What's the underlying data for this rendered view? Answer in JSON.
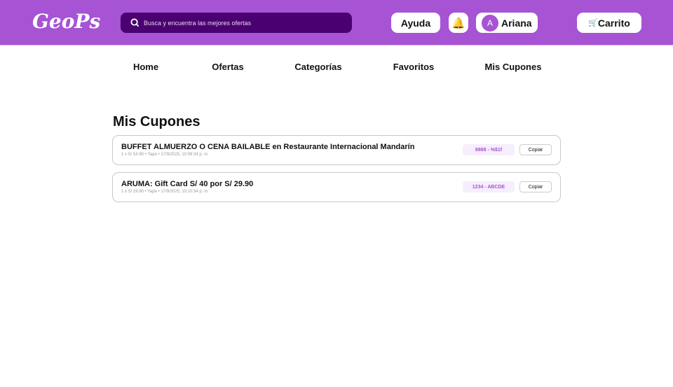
{
  "header": {
    "logo": "GeoPs",
    "search_placeholder": "Busca y encuentra las mejores ofertas",
    "help": "Ayuda",
    "bell": "🔔",
    "avatar_initial": "A",
    "user": "Ariana",
    "cart_icon": "🛒",
    "cart": "Carrito"
  },
  "nav": [
    "Home",
    "Ofertas",
    "Categorías",
    "Favoritos",
    "Mis Cupones"
  ],
  "page_title": "Mis Cupones",
  "coupons": [
    {
      "title": "BUFFET ALMUERZO O CENA BAILABLE en Restaurante Internacional Mandarín",
      "meta": "1 x S/ 54.90 • Yape • 17/9/2025, 10:09:34 p. m.",
      "code": "8888 - %$1f",
      "copy": "Copiar"
    },
    {
      "title": "ARUMA: Gift Card S/ 40 por S/ 29.90",
      "meta": "1 x S/ 29.90 • Yape • 17/9/2025, 10:10:34 p. m.",
      "code": "1234 - ABCDE",
      "copy": "Copiar"
    }
  ]
}
